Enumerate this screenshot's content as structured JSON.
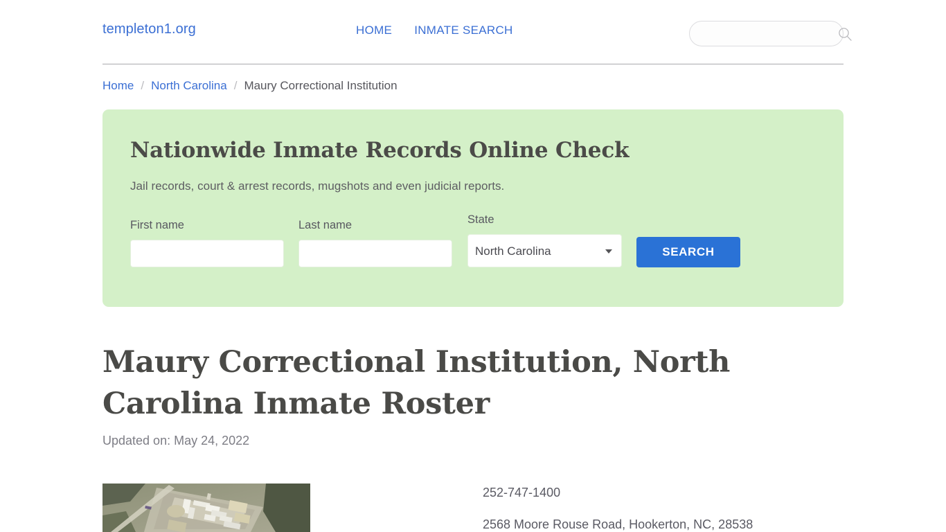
{
  "header": {
    "brand": "templeton1.org",
    "nav": [
      {
        "label": "HOME",
        "name": "nav-home"
      },
      {
        "label": "INMATE SEARCH",
        "name": "nav-inmate-search"
      }
    ],
    "search": {
      "value": "",
      "placeholder": "",
      "icon": "search-icon"
    }
  },
  "breadcrumb": {
    "items": [
      {
        "label": "Home",
        "link": true
      },
      {
        "label": "North Carolina",
        "link": true
      },
      {
        "label": "Maury Correctional Institution",
        "link": false
      }
    ],
    "separator": "/"
  },
  "promo": {
    "title": "Nationwide Inmate Records Online Check",
    "subtitle": "Jail records, court & arrest records, mugshots and even judicial reports.",
    "background_color": "#d4f0c8",
    "form": {
      "first_name": {
        "label": "First name",
        "value": "",
        "placeholder": ""
      },
      "last_name": {
        "label": "Last name",
        "value": "",
        "placeholder": ""
      },
      "state": {
        "label": "State",
        "selected": "North Carolina",
        "options": [
          "North Carolina"
        ]
      },
      "submit_label": "SEARCH",
      "submit_color": "#2a72d6"
    }
  },
  "main": {
    "page_title": "Maury Correctional Institution, North Carolina Inmate Roster",
    "updated": "Updated on: May 24, 2022",
    "facility": {
      "photo_alt": "aerial-view-of-maury-correctional-institution",
      "phone": "252-747-1400",
      "address": "2568 Moore Rouse Road, Hookerton, NC, 28538"
    }
  }
}
